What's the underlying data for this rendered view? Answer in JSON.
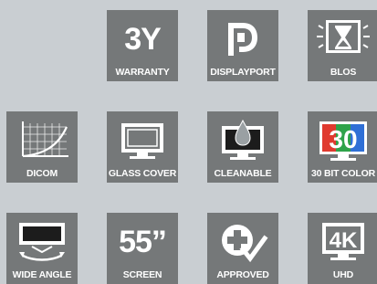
{
  "tiles": [
    {
      "label": "WARRANTY",
      "icon": "warranty-icon",
      "text": "3Y"
    },
    {
      "label": "DISPLAYPORT",
      "icon": "displayport-icon"
    },
    {
      "label": "BLOS",
      "icon": "hourglass-monitor-icon"
    },
    {
      "label": "DICOM",
      "icon": "dicom-curve-icon"
    },
    {
      "label": "GLASS COVER",
      "icon": "monitor-glass-icon"
    },
    {
      "label": "CLEANABLE",
      "icon": "droplet-monitor-icon"
    },
    {
      "label": "30 BIT COLOR",
      "icon": "rgb-30-icon",
      "text": "30"
    },
    {
      "label": "WIDE ANGLE",
      "icon": "wide-angle-icon"
    },
    {
      "label": "SCREEN",
      "icon": "screen-size-icon",
      "text": "55”"
    },
    {
      "label": "APPROVED",
      "icon": "approved-cross-check-icon"
    },
    {
      "label": "UHD",
      "icon": "uhd-4k-icon",
      "text": "4K"
    }
  ],
  "colors": {
    "background": "#c9ced2",
    "tile": "#757879",
    "text": "#ffffff",
    "red": "#e03a2f",
    "green": "#2fa34a",
    "blue": "#2f6fd6"
  }
}
